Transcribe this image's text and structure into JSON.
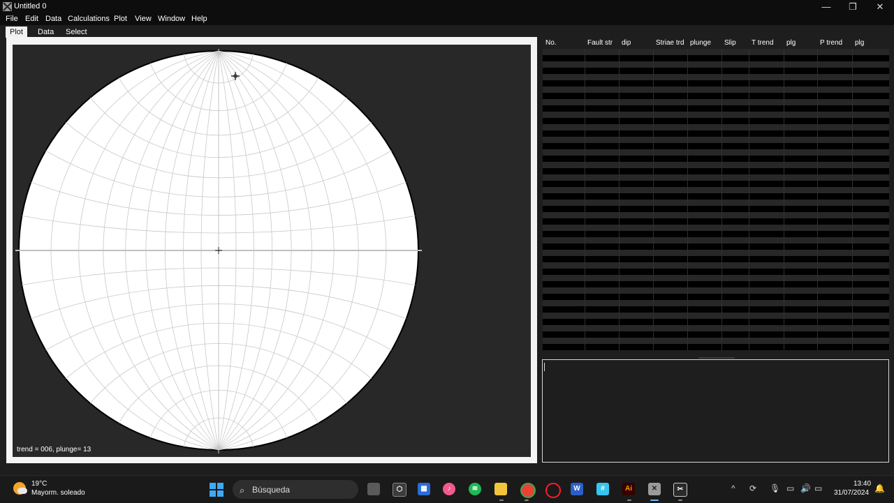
{
  "window": {
    "title": "Untitled 0",
    "minimize": "—",
    "restore": "❐",
    "close": "✕"
  },
  "menu": [
    "File",
    "Edit",
    "Data",
    "Calculations",
    "Plot",
    "View",
    "Window",
    "Help"
  ],
  "tabs": [
    "Plot",
    "Data",
    "Select"
  ],
  "active_tab": "Plot",
  "plot": {
    "status": "trend = 006, plunge= 13"
  },
  "table": {
    "columns": [
      "No.",
      "Fault str",
      "dip",
      "Striae trd",
      "plunge",
      "Slip",
      "T trend",
      "plg",
      "P trend",
      "plg"
    ],
    "row_count": 48
  },
  "taskbar": {
    "weather_temp": "19°C",
    "weather_desc": "Mayorm. soleado",
    "search_placeholder": "Búsqueda",
    "time": "13:40",
    "date": "31/07/2024",
    "apps": [
      "task-view-icon",
      "store-app-icon",
      "ms-store-icon",
      "itunes-icon",
      "spotify-icon",
      "file-explorer-icon",
      "chrome-icon",
      "opera-icon",
      "word-icon",
      "slack-icon",
      "illustrator-icon",
      "stereonet-app-icon",
      "snipping-tool-icon"
    ]
  },
  "colors": {
    "accent": "#3fa9f5",
    "background": "#1e1e1e",
    "net_lines": "#c8c8c8"
  }
}
